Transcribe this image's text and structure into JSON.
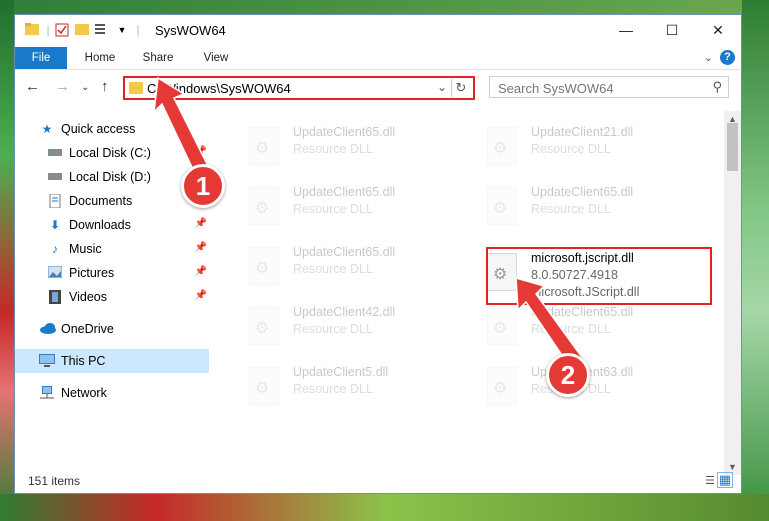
{
  "window": {
    "title": "SysWOW64"
  },
  "ribbon": {
    "tabs": [
      "File",
      "Home",
      "Share",
      "View"
    ],
    "help": "?"
  },
  "address": {
    "path": "C:\\Windows\\SysWOW64"
  },
  "search": {
    "placeholder": "Search SysWOW64"
  },
  "nav": {
    "items": [
      {
        "label": "Quick access",
        "icon": "star-icon",
        "pinned": false
      },
      {
        "label": "Local Disk (C:)",
        "icon": "drive-icon",
        "pinned": true
      },
      {
        "label": "Local Disk (D:)",
        "icon": "drive-icon",
        "pinned": true
      },
      {
        "label": "Documents",
        "icon": "documents-icon",
        "pinned": true
      },
      {
        "label": "Downloads",
        "icon": "download-icon",
        "pinned": true
      },
      {
        "label": "Music",
        "icon": "music-icon",
        "pinned": true
      },
      {
        "label": "Pictures",
        "icon": "pictures-icon",
        "pinned": true
      },
      {
        "label": "Videos",
        "icon": "videos-icon",
        "pinned": true
      },
      {
        "label": "OneDrive",
        "icon": "cloud-icon",
        "pinned": false
      },
      {
        "label": "This PC",
        "icon": "computer-icon",
        "pinned": false,
        "selected": true
      },
      {
        "label": "Network",
        "icon": "network-icon",
        "pinned": false
      }
    ]
  },
  "files": {
    "left": [
      {
        "name": "UpdateClient65.dll",
        "type": "Resource DLL"
      },
      {
        "name": "UpdateClient65.dll",
        "type": "Resource DLL"
      },
      {
        "name": "UpdateClient65.dll",
        "type": "Resource DLL"
      },
      {
        "name": "UpdateClient42.dll",
        "type": "Resource DLL"
      },
      {
        "name": "UpdateClient5.dll",
        "type": "Resource DLL"
      }
    ],
    "right": [
      {
        "name": "UpdateClient21.dll",
        "type": "Resource DLL"
      },
      {
        "name": "UpdateClient65.dll",
        "type": "Resource DLL"
      },
      {
        "name": "microsoft.jscript.dll",
        "version": "8.0.50727.4918",
        "description": "Microsoft.JScript.dll",
        "highlighted": true
      },
      {
        "name": "UpdateClient65.dll",
        "type": "Resource DLL"
      },
      {
        "name": "UpdateClient63.dll",
        "type": "Resource DLL"
      }
    ]
  },
  "status": {
    "item_count": "151 items"
  },
  "annotations": {
    "step1": "1",
    "step2": "2",
    "color": "#e53935"
  }
}
